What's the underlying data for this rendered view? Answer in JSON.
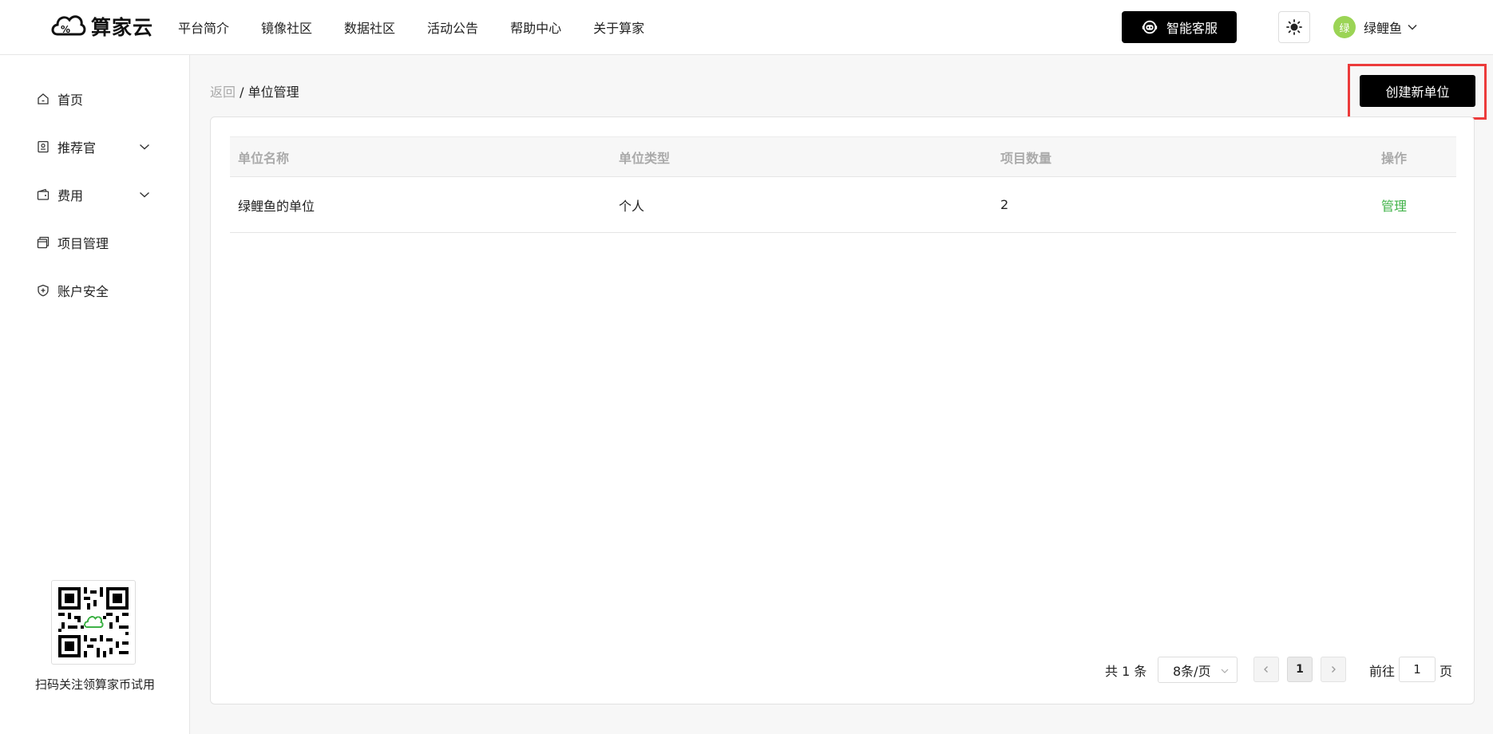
{
  "header": {
    "brand": "算家云",
    "nav": [
      "平台简介",
      "镜像社区",
      "数据社区",
      "活动公告",
      "帮助中心",
      "关于算家"
    ],
    "service_button": "智能客服",
    "theme_icon": "sun-icon",
    "user": {
      "avatar_text": "绿",
      "avatar_color": "#9bd455",
      "name": "绿鲤鱼"
    }
  },
  "sidebar": {
    "items": [
      {
        "label": "首页",
        "icon": "home-icon"
      },
      {
        "label": "推荐官",
        "icon": "badge-icon",
        "expandable": true
      },
      {
        "label": "费用",
        "icon": "wallet-icon",
        "expandable": true
      },
      {
        "label": "项目管理",
        "icon": "project-icon"
      },
      {
        "label": "账户安全",
        "icon": "shield-icon"
      }
    ],
    "qr_caption": "扫码关注领算家币试用"
  },
  "main": {
    "breadcrumb": {
      "back": "返回",
      "separator": " / ",
      "current": "单位管理"
    },
    "create_button": "创建新单位",
    "table": {
      "columns": [
        "单位名称",
        "单位类型",
        "项目数量",
        "操作"
      ],
      "rows": [
        {
          "name": "绿鲤鱼的单位",
          "type": "个人",
          "count": "2",
          "action": "管理"
        }
      ]
    },
    "pagination": {
      "total": "共 1 条",
      "page_size": "8条/页",
      "current_page": "1",
      "goto_label": "前往",
      "goto_value": "1",
      "page_suffix": "页"
    }
  },
  "colors": {
    "accent": "#3fb247",
    "highlight": "#ec3b3b",
    "button_bg": "#000000"
  }
}
